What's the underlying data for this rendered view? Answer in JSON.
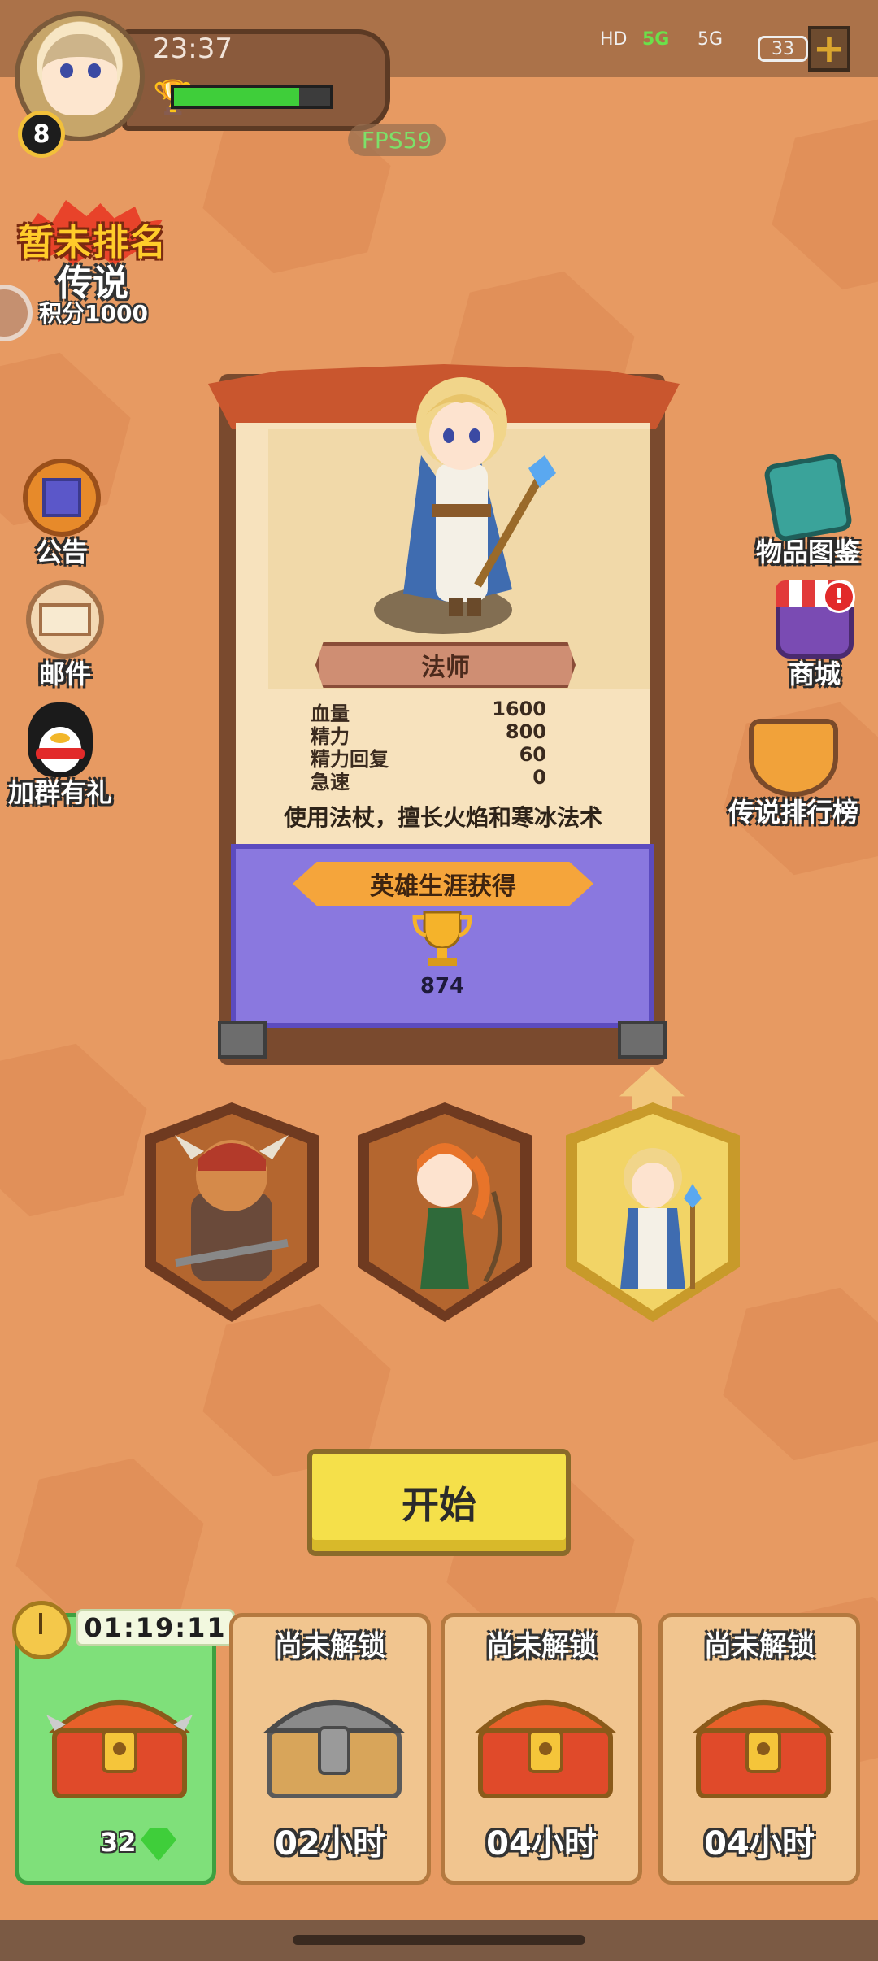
{
  "status_bar": {
    "time": "23:37",
    "network": [
      "HD",
      "5G",
      "5G"
    ],
    "battery": "33"
  },
  "profile": {
    "level": "8",
    "player_name": "",
    "xp_progress": 0.8,
    "fps": "FPS59"
  },
  "rank": {
    "title": "暂未排名",
    "league": "传说",
    "score": "积分1000"
  },
  "left_menu": [
    {
      "label": "公告",
      "icon": "notice-board-icon"
    },
    {
      "label": "邮件",
      "icon": "mail-icon"
    },
    {
      "label": "加群有礼",
      "icon": "penguin-icon"
    }
  ],
  "right_menu": [
    {
      "label": "物品图鉴",
      "icon": "book-icon"
    },
    {
      "label": "商城",
      "icon": "shop-icon",
      "badge": "!"
    },
    {
      "label": "传说排行榜",
      "icon": "leaderboard-banner-icon"
    }
  ],
  "hero": {
    "class_name": "法师",
    "stats": [
      {
        "label": "血量",
        "value": "1600"
      },
      {
        "label": "精力",
        "value": "800"
      },
      {
        "label": "精力回复",
        "value": "60"
      },
      {
        "label": "急速",
        "value": "0"
      }
    ],
    "description": "使用法杖，擅长火焰和寒冰法术",
    "career_label": "英雄生涯获得",
    "career_value": "874"
  },
  "hero_select": [
    {
      "name": "warrior",
      "selected": false
    },
    {
      "name": "archer",
      "selected": false
    },
    {
      "name": "mage",
      "selected": true
    }
  ],
  "start_button": "开始",
  "chests": [
    {
      "header": "01:19:11",
      "footer": "32",
      "active": true,
      "type": "red-chest"
    },
    {
      "header": "尚未解锁",
      "footer": "02小时",
      "active": false,
      "type": "grey-chest"
    },
    {
      "header": "尚未解锁",
      "footer": "04小时",
      "active": false,
      "type": "red-chest"
    },
    {
      "header": "尚未解锁",
      "footer": "04小时",
      "active": false,
      "type": "red-chest"
    }
  ],
  "colors": {
    "background": "#e79a62",
    "career_panel": "#8a78df",
    "start_button": "#f5e04a",
    "active_chest_slot": "#7fe07a"
  }
}
